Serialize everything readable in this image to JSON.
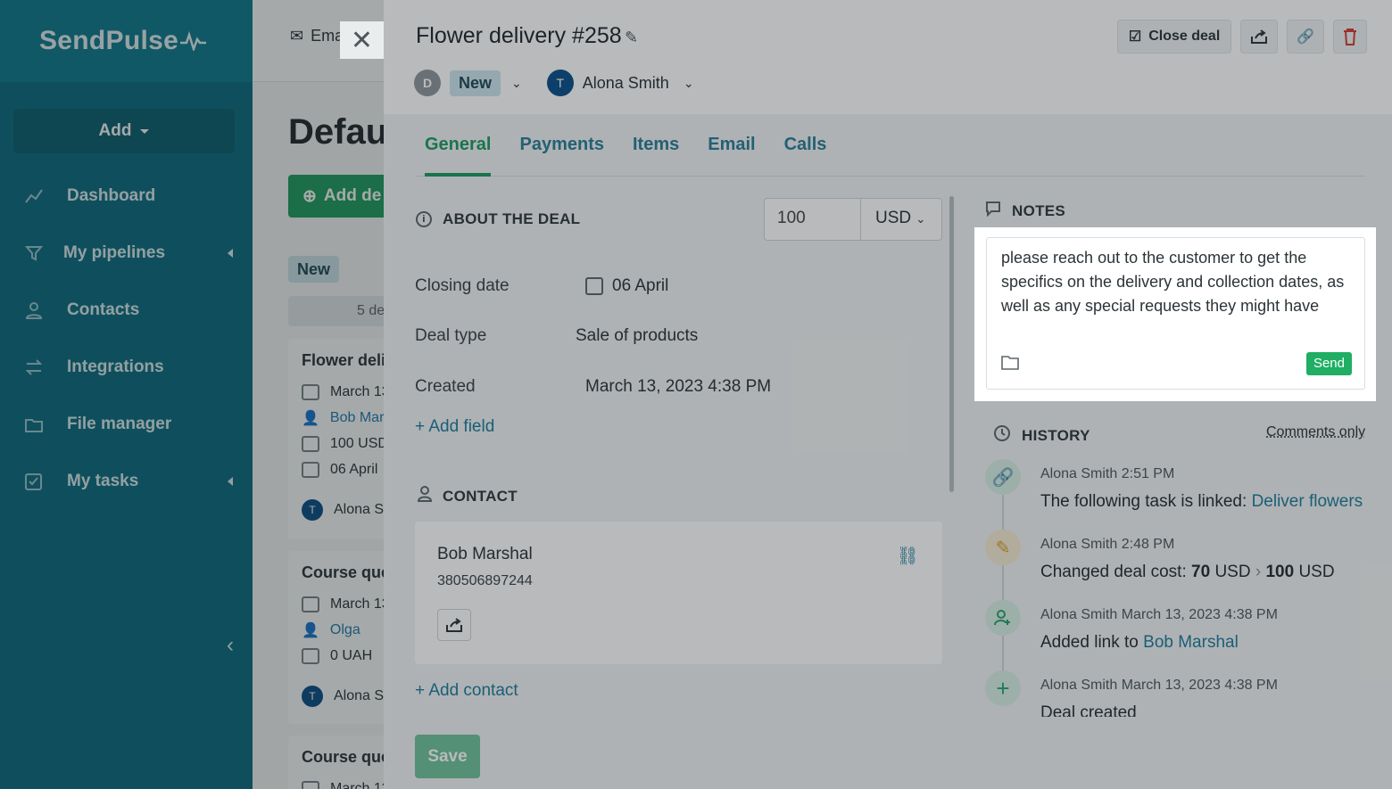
{
  "sidebar": {
    "logo": "SendPulse",
    "add_label": "Add",
    "items": [
      {
        "label": "Dashboard",
        "icon": "chart-line-icon"
      },
      {
        "label": "My pipelines",
        "icon": "funnel-icon"
      },
      {
        "label": "Contacts",
        "icon": "person-icon"
      },
      {
        "label": "Integrations",
        "icon": "arrows-icon"
      },
      {
        "label": "File manager",
        "icon": "folder-icon"
      },
      {
        "label": "My tasks",
        "icon": "checkbox-icon"
      }
    ]
  },
  "background": {
    "email_tab": "Ema",
    "title": "Defau",
    "add_deal": "Add de",
    "stage": "New",
    "stage_count": "5 de",
    "cards": [
      {
        "title": "Flower deli",
        "date": "March 13",
        "contact": "Bob Mar",
        "amount": "100 USD",
        "close": "06 April",
        "owner": "Alona S",
        "avatar": "T"
      },
      {
        "title": "Course que",
        "date": "March 13",
        "contact": "Olga",
        "amount": "0 UAH",
        "owner": "Alona S",
        "avatar": "T"
      },
      {
        "title": "Course que",
        "date": "March 13"
      }
    ]
  },
  "deal": {
    "title": "Flower delivery #258",
    "close_label": "Close deal",
    "stage_initial": "D",
    "stage": "New",
    "owner_initial": "T",
    "owner": "Alona Smith",
    "tabs": [
      "General",
      "Payments",
      "Items",
      "Email",
      "Calls"
    ],
    "about_heading": "ABOUT THE DEAL",
    "amount": "100",
    "currency": "USD",
    "fields": [
      {
        "label": "Closing date",
        "value": "06 April"
      },
      {
        "label": "Deal type",
        "value": "Sale of products"
      },
      {
        "label": "Created",
        "value": "March 13, 2023 4:38 PM"
      }
    ],
    "add_field": "+ Add field",
    "contact_heading": "CONTACT",
    "contact_name": "Bob Marshal",
    "contact_phone": "380506897244",
    "add_contact": "+ Add contact",
    "save": "Save"
  },
  "notes": {
    "heading": "NOTES",
    "text": "please reach out to the customer to get the specifics on the delivery and collection dates, as well as any special requests they might have",
    "send": "Send"
  },
  "history": {
    "heading": "HISTORY",
    "filter": "Comments only",
    "items": [
      {
        "author": "Alona Smith",
        "time": "2:51 PM",
        "text": "The following task is linked:",
        "link": "Deliver flowers",
        "color": "#2aa36b"
      },
      {
        "author": "Alona Smith",
        "time": "2:48 PM",
        "text": "Changed deal cost:",
        "from": "70",
        "from_unit": "USD",
        "to": "100",
        "to_unit": "USD",
        "color": "#e0a62a"
      },
      {
        "author": "Alona Smith",
        "time": "March 13, 2023 4:38 PM",
        "text": "Added link to",
        "link": "Bob Marshal",
        "color": "#2aa36b"
      },
      {
        "author": "Alona Smith",
        "time": "March 13, 2023 4:38 PM",
        "text": "Deal created",
        "color": "#2aa36b"
      }
    ]
  }
}
